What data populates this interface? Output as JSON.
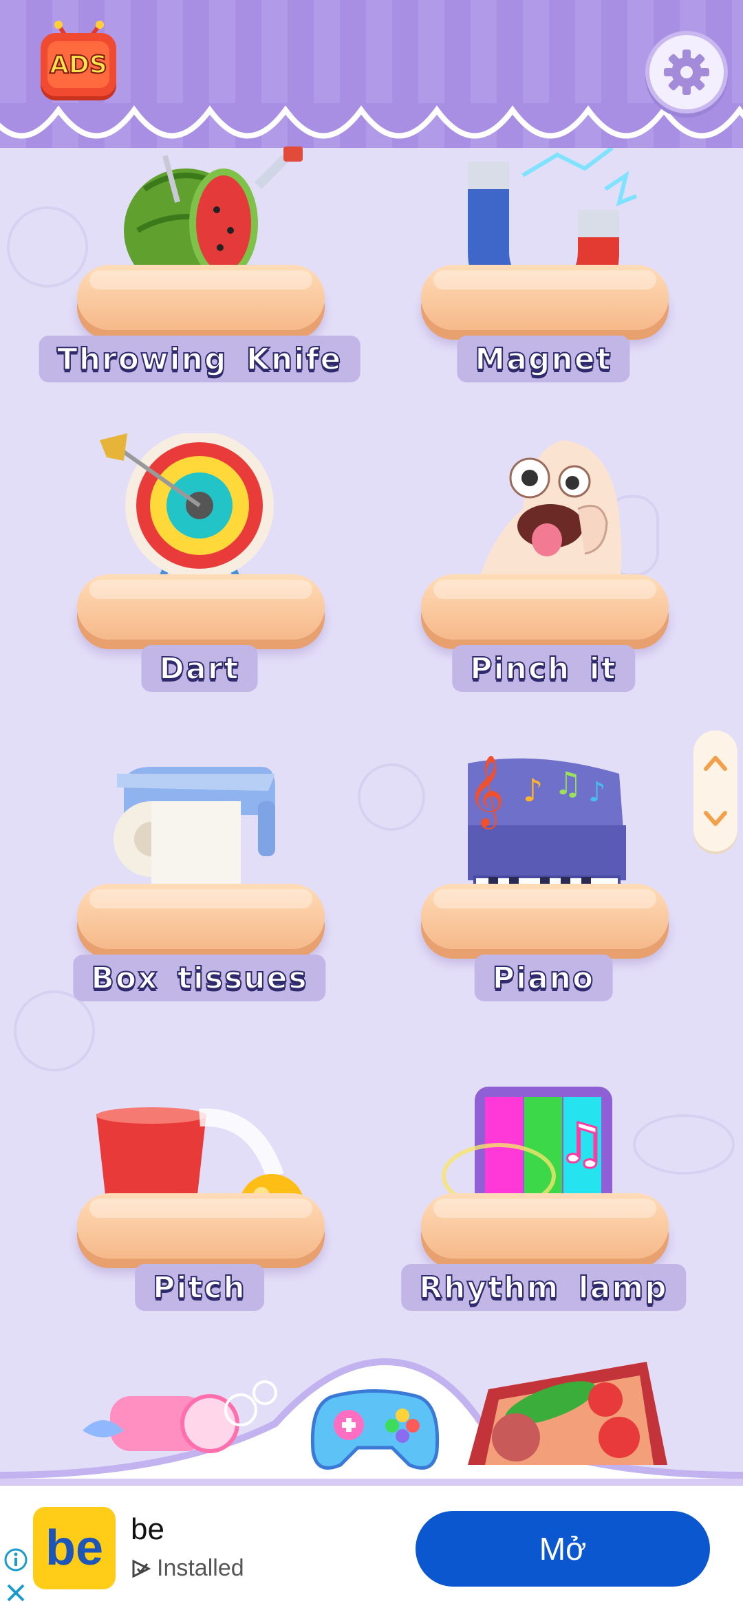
{
  "header": {
    "ads_badge": "ADS",
    "settings_icon": "gear-icon"
  },
  "games": [
    {
      "label": "Throwing Knife",
      "icon": "watermelon-knife-icon"
    },
    {
      "label": "Magnet",
      "icon": "magnet-icon"
    },
    {
      "label": "Dart",
      "icon": "dartboard-icon"
    },
    {
      "label": "Pinch it",
      "icon": "pinched-face-icon"
    },
    {
      "label": "Box tissues",
      "icon": "tissue-box-icon"
    },
    {
      "label": "Piano",
      "icon": "piano-icon"
    },
    {
      "label": "Pitch",
      "icon": "cup-ball-icon"
    },
    {
      "label": "Rhythm lamp",
      "icon": "rhythm-lamp-icon"
    }
  ],
  "scroll": {
    "up_icon": "chevron-up-icon",
    "down_icon": "chevron-down-icon"
  },
  "dock": {
    "icon_left": "bubble-gun-icon",
    "icon_center": "gamepad-icon",
    "icon_right": "food-tray-icon"
  },
  "ad": {
    "app_name": "be",
    "status": "Installed",
    "open_label": "Mở",
    "logo_text": "be",
    "colors": {
      "button": "#0b57d0",
      "logo": "#ffcc17"
    }
  },
  "colors": {
    "background": "#e3def8",
    "curtain": "#b19ae8",
    "plate": "#f6b98a",
    "label_bg": "#c2b6e6"
  }
}
